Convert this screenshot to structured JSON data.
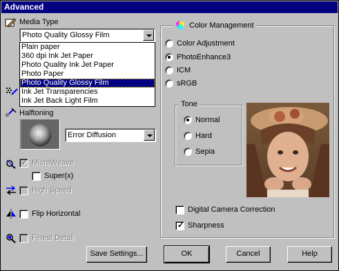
{
  "window": {
    "title": "Advanced"
  },
  "media_type": {
    "label": "Media Type",
    "selected": "Photo Quality Glossy Film",
    "options": [
      "Plain paper",
      "360 dpi Ink Jet Paper",
      "Photo Quality Ink Jet Paper",
      "Photo Paper",
      "Photo Quality Glossy Film",
      "Ink Jet Transparencies",
      "Ink Jet Back Light Film"
    ],
    "highlighted_index": 4
  },
  "halftoning": {
    "label": "Halftoning",
    "selected": "Error Diffusion"
  },
  "microweave": {
    "label": "MicroWeave",
    "checked": true,
    "enabled": false
  },
  "super": {
    "label": "Super(x)",
    "checked": false
  },
  "high_speed": {
    "label": "High Speed",
    "checked": false,
    "enabled": false
  },
  "flip_horizontal": {
    "label": "Flip Horizontal",
    "checked": false
  },
  "finest_detail": {
    "label": "Finest Detail",
    "checked": false,
    "enabled": false
  },
  "color_management": {
    "label": "Color Management",
    "options": [
      "Color Adjustment",
      "PhotoEnhance3",
      "ICM",
      "sRGB"
    ],
    "selected_index": 1
  },
  "tone": {
    "label": "Tone",
    "options": [
      "Normal",
      "Hard",
      "Sepia"
    ],
    "selected_index": 0
  },
  "digital_camera_correction": {
    "label": "Digital Camera Correction",
    "checked": false
  },
  "sharpness": {
    "label": "Sharpness",
    "checked": true
  },
  "buttons": {
    "save_settings": "Save Settings...",
    "ok": "OK",
    "cancel": "Cancel",
    "help": "Help"
  },
  "colors": {
    "titlebar": "#000080",
    "face": "#c0c0c0",
    "highlight": "#000080"
  }
}
